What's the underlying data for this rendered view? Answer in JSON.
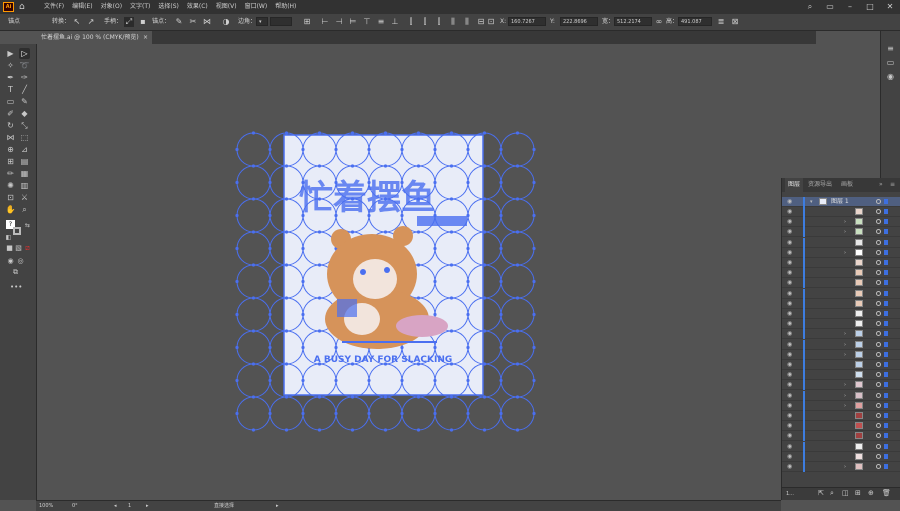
{
  "app": {
    "logo": "Ai"
  },
  "menus": [
    "文件(F)",
    "编辑(E)",
    "对象(O)",
    "文字(T)",
    "选择(S)",
    "效果(C)",
    "视图(V)",
    "窗口(W)",
    "帮助(H)"
  ],
  "control": {
    "anchor_label": "锚点",
    "convert_label": "转换：",
    "handle_label": "手柄：",
    "anchors_label": "锚点：",
    "corner_label": "边角：",
    "x_label": "X:",
    "x_value": "160.7267",
    "y_label": "Y:",
    "y_value": "222.8696",
    "w_label": "宽：",
    "w_value": "512.2174",
    "h_label": "高：",
    "h_value": "491.087"
  },
  "document": {
    "tab_title": "忙着摆鱼.ai @ 100 % (CMYK/预览)",
    "close": "×"
  },
  "layers_panel": {
    "tabs": [
      "图层",
      "资源导出",
      "画板"
    ],
    "top_layer_name": "图层 1",
    "footer_count": "1..."
  },
  "status": {
    "zoom": "100%",
    "rotation": "0°",
    "artboard": "1",
    "tool_name": "直接选择"
  },
  "artwork": {
    "title_text": "忙着摆鱼",
    "subtitle_text": "A BUSY DAY FOR SLACKING",
    "accent": "#4a6ff0",
    "paper": "#e8ecf8"
  }
}
